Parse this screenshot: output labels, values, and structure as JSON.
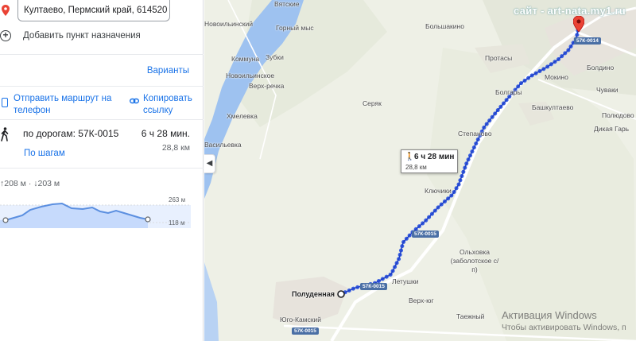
{
  "panel": {
    "destination": "Култаево, Пермский край, 614520",
    "add_destination": "Добавить пункт назначения",
    "variants": "Варианты",
    "send_to_phone": "Отправить маршрут на телефон",
    "copy_link": "Копировать ссылку",
    "route": {
      "name": "по дорогам: 57К-0015",
      "time": "6 ч 28 мин.",
      "distance": "28,8 км",
      "steps_link": "По шагам"
    },
    "elevation": {
      "summary": "↑208 м · ↓203 м",
      "max_label": "263 м",
      "min_label": "118 м"
    }
  },
  "map": {
    "watermark": "сайт - art-nata.my1.ru",
    "route_box": {
      "time": "6 ч 28 мин",
      "distance": "28,8 км"
    },
    "places": {
      "vyatskie": "Вятские",
      "novoilinsky": "Новоильинский",
      "gorny_mys": "Горный мыс",
      "bolshakino": "Большакино",
      "kommuna": "Коммуна",
      "zubki": "Зубки",
      "protasy": "Протасы",
      "boldino": "Болдино",
      "novoilinskoe": "Новоильинское",
      "verh_rechka": "Верх-речка",
      "mokino": "Мокино",
      "chuvaki": "Чуваки",
      "bolgary": "Болгары",
      "seryak": "Серяк",
      "bashkultaevo": "Башкултаево",
      "polyudovo": "Полюдово",
      "hmelevka": "Хмелевка",
      "stepanovo": "Степаново",
      "dikaya_gar": "Дикая Гарь",
      "vasilyevka": "Васильевка",
      "klyuchiki": "Ключики",
      "olhovka": "Ольховка (заболотское с/п)",
      "poludennaya": "Полуденная",
      "letushki": "Летушки",
      "verh_yug": "Верх-юг",
      "yugo_kamsky": "Юго-Камский",
      "taezhny": "Таежный"
    },
    "roads": {
      "r1": "57К-0014",
      "r2": "57К-0015",
      "r3": "57К-0015",
      "r4": "57К-0015"
    },
    "activation": {
      "line1": "Активация Windows",
      "line2": "Чтобы активировать Windows, п"
    }
  },
  "colors": {
    "route": "#3a5fe0",
    "link": "#1a73e8",
    "water": "#9ec2f0",
    "pin": "#ea4335"
  }
}
